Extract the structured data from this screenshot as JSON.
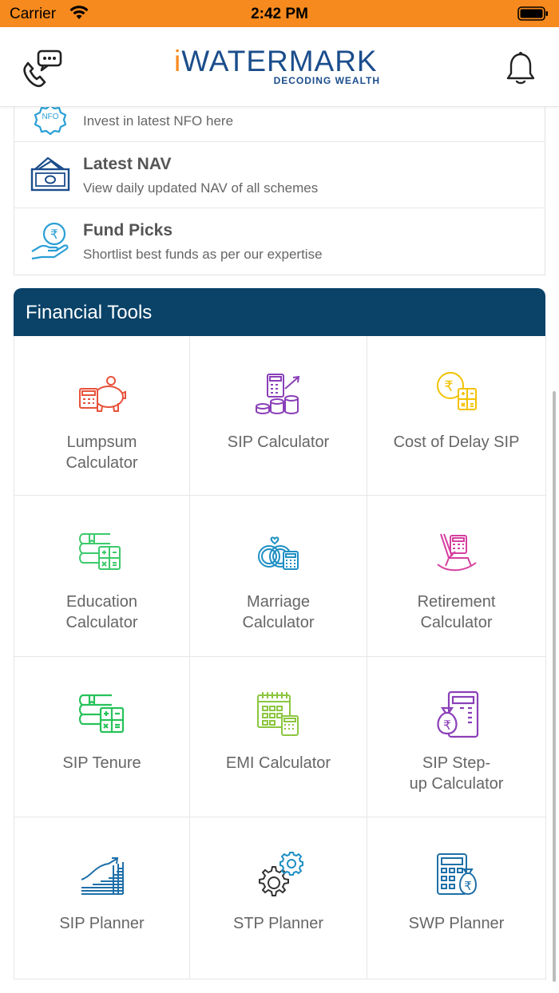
{
  "status_bar": {
    "carrier": "Carrier",
    "time": "2:42 PM"
  },
  "header": {
    "brand": "WATERMARK",
    "brand_prefix": "i",
    "tagline": "DECODING WEALTH"
  },
  "menu": {
    "items": [
      {
        "title": "",
        "subtitle": "Invest in latest NFO here",
        "icon": "nfo-badge-icon",
        "icon_text": "NFO"
      },
      {
        "title": "Latest NAV",
        "subtitle": "View daily updated NAV of all schemes",
        "icon": "money-notes-icon"
      },
      {
        "title": "Fund Picks",
        "subtitle": "Shortlist best funds as per our expertise",
        "icon": "rupee-hand-icon"
      }
    ]
  },
  "tools": {
    "title": "Financial Tools",
    "items": [
      {
        "label": "Lumpsum\nCalculator",
        "icon": "piggy-bank-calculator-icon",
        "color": "#e8513a"
      },
      {
        "label": "SIP Calculator",
        "icon": "calculator-coins-icon",
        "color": "#8a3fb8"
      },
      {
        "label": "Cost of Delay SIP",
        "icon": "rupee-coin-calculator-icon",
        "color": "#f2c200"
      },
      {
        "label": "Education\nCalculator",
        "icon": "books-calculator-icon",
        "color": "#3cc96b"
      },
      {
        "label": "Marriage\nCalculator",
        "icon": "rings-calculator-icon",
        "color": "#1e8fc4"
      },
      {
        "label": "Retirement\nCalculator",
        "icon": "rocking-chair-icon",
        "color": "#d6409f"
      },
      {
        "label": "SIP Tenure",
        "icon": "books-calculator-icon",
        "color": "#27c25a"
      },
      {
        "label": "EMI Calculator",
        "icon": "calendar-calculator-icon",
        "color": "#8cc63f"
      },
      {
        "label": "SIP Step-\nup Calculator",
        "icon": "money-bag-calculator-icon",
        "color": "#8a3fb8"
      },
      {
        "label": "SIP Planner",
        "icon": "growth-bars-icon",
        "color": "#1e6fa8"
      },
      {
        "label": "STP Planner",
        "icon": "gears-icon",
        "color": "#333333"
      },
      {
        "label": "SWP Planner",
        "icon": "calculator-rupee-bag-icon",
        "color": "#1e6fa8"
      }
    ]
  },
  "colors": {
    "status_bar": "#f78a1e",
    "tools_header": "#0a4268",
    "brand_blue": "#1b4d8c"
  }
}
